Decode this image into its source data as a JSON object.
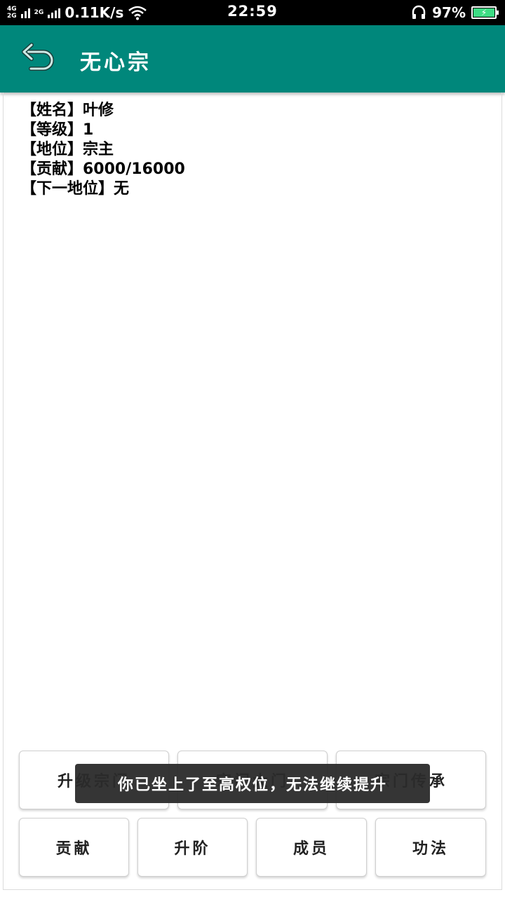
{
  "status_bar": {
    "net_type_1": "4G",
    "net_type_2": "2G",
    "net_type_3": "2G",
    "speed": "0.11K/s",
    "time": "22:59",
    "battery_percent": "97%",
    "battery_level": 0.97
  },
  "app_bar": {
    "title": "无心宗"
  },
  "info": {
    "name": "【姓名】叶修",
    "level": "【等级】1",
    "position": "【地位】宗主",
    "contribution": "【贡献】6000/16000",
    "next_position": "【下一地位】无"
  },
  "buttons_row1": [
    "升级宗门",
    "宗门大门",
    "宗门传承"
  ],
  "buttons_row2": [
    "贡献",
    "升阶",
    "成员",
    "功法"
  ],
  "toast": "你已坐上了至高权位，无法继续提升",
  "colors": {
    "primary": "#00877b",
    "status_bar": "#000000",
    "battery_fill": "#3ddc84"
  }
}
